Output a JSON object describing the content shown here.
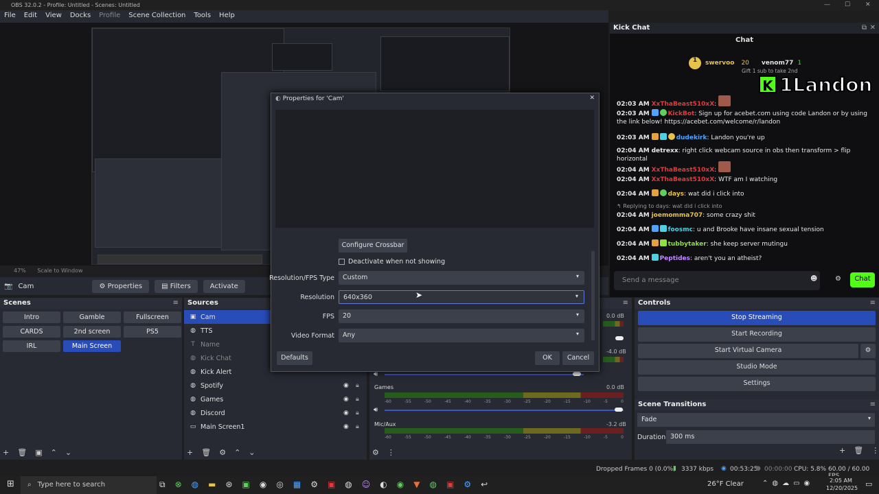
{
  "window": {
    "title": "OBS 32.0.2 - Profile: Untitled - Scenes: Untitled"
  },
  "menu": [
    "File",
    "Edit",
    "View",
    "Docks",
    "Profile",
    "Scene Collection",
    "Tools",
    "Help"
  ],
  "preview": {
    "zoom": "47%",
    "scale_mode": "Scale to Window"
  },
  "source_bar": {
    "name": "Cam",
    "properties": "Properties",
    "filters": "Filters",
    "activate": "Activate"
  },
  "scenes": {
    "title": "Scenes",
    "items": [
      "Intro",
      "Gamble",
      "Fullscreen",
      "CARDS",
      "2nd screen",
      "PS5",
      "IRL",
      "Main Screen"
    ],
    "selected": "Main Screen"
  },
  "sources": {
    "title": "Sources",
    "items": [
      {
        "name": "Cam",
        "icon": "camera-icon",
        "selected": true
      },
      {
        "name": "TTS",
        "icon": "globe-icon"
      },
      {
        "name": "Name",
        "icon": "text-icon",
        "dim": true
      },
      {
        "name": "Kick Chat",
        "icon": "globe-icon",
        "dim": true
      },
      {
        "name": "Kick Alert",
        "icon": "globe-icon"
      },
      {
        "name": "Spotify",
        "icon": "globe-icon"
      },
      {
        "name": "Games",
        "icon": "globe-icon"
      },
      {
        "name": "Discord",
        "icon": "globe-icon"
      },
      {
        "name": "Main Screen1",
        "icon": "display-icon"
      }
    ]
  },
  "mixer": {
    "channels": [
      {
        "name": "",
        "db": "0.0 dB"
      },
      {
        "name": "",
        "db": "-4.0 dB"
      },
      {
        "name": "Games",
        "db": "0.0 dB"
      },
      {
        "name": "Mic/Aux",
        "db": "-3.2 dB"
      }
    ],
    "scale": [
      "-60",
      "-55",
      "-50",
      "-45",
      "-40",
      "-35",
      "-30",
      "-25",
      "-20",
      "-15",
      "-10",
      "-5",
      "0"
    ]
  },
  "controls": {
    "title": "Controls",
    "buttons": [
      "Stop Streaming",
      "Start Recording",
      "Start Virtual Camera",
      "Studio Mode",
      "Settings"
    ]
  },
  "transitions": {
    "title": "Scene Transitions",
    "type": "Fade",
    "duration_label": "Duration",
    "duration": "300 ms"
  },
  "status": {
    "dropped": "Dropped Frames 0 (0.0%)",
    "kbps": "3337 kbps",
    "stream_time": "00:53:25",
    "rec_time": "00:00:00",
    "cpu": "CPU: 5.8%",
    "fps": "60.00 / 60.00 FPS"
  },
  "dialog": {
    "title": "Properties for 'Cam'",
    "configure": "Configure Crossbar",
    "deactivate": "Deactivate when not showing",
    "rows": [
      {
        "label": "Resolution/FPS Type",
        "value": "Custom"
      },
      {
        "label": "Resolution",
        "value": "640x360"
      },
      {
        "label": "FPS",
        "value": "20"
      },
      {
        "label": "Video Format",
        "value": "Any"
      }
    ],
    "defaults": "Defaults",
    "ok": "OK",
    "cancel": "Cancel"
  },
  "chat": {
    "dock_title": "Kick Chat",
    "header": "Chat",
    "pinned_user": "swervoo",
    "pinned_count": "20",
    "gifter": "venom77",
    "gifter_count": "1",
    "gift_text": "Gift 1 sub to take 2nd",
    "overlay_logo": "K",
    "overlay_name": "1Landon",
    "messages": [
      {
        "time": "02:03 AM",
        "user": "XxThaBeast510xX",
        "text": ":",
        "cls": "n-red"
      },
      {
        "time": "02:03 AM",
        "user": "KickBot",
        "text": ": Sign up for acebet.com using code Landon or by using the link below! https://acebet.com/welcome/r/landon",
        "cls": "n-red"
      },
      {
        "time": "02:03 AM",
        "user": "dudekirk",
        "text": ": Landon you're up",
        "cls": "n-blue"
      },
      {
        "time": "02:04 AM",
        "user": "detrexx",
        "text": ": right click webcam source in obs then transform > flip horizontal",
        "cls": "t"
      },
      {
        "time": "02:04 AM",
        "user": "XxThaBeast510xX",
        "text": ":",
        "cls": "n-red"
      },
      {
        "time": "02:04 AM",
        "user": "XxThaBeast510xX",
        "text": ": WTF am I watching",
        "cls": "n-red"
      },
      {
        "time": "02:04 AM",
        "user": "days",
        "text": ": wat did i click into",
        "cls": "n-yellow"
      },
      {
        "time": "",
        "user": "",
        "text": "Replying to days: wat did i click into",
        "cls": "t"
      },
      {
        "time": "02:04 AM",
        "user": "joemomma707",
        "text": ": some crazy shit",
        "cls": "n-yellow"
      },
      {
        "time": "02:04 AM",
        "user": "foosmc",
        "text": ": u and Brooke have insane sexual tension",
        "cls": "n-cyan"
      },
      {
        "time": "02:04 AM",
        "user": "tubbytaker",
        "text": ": she keep server mutingu",
        "cls": "n-lime"
      },
      {
        "time": "02:04 AM",
        "user": "Peptides",
        "text": ": aren't you an atheist?",
        "cls": "n-purple"
      }
    ],
    "input_placeholder": "Send a message",
    "send": "Chat"
  },
  "taskbar": {
    "search": "Type here to search",
    "weather": "26°F  Clear",
    "time": "2:05 AM",
    "date": "12/20/2025"
  }
}
